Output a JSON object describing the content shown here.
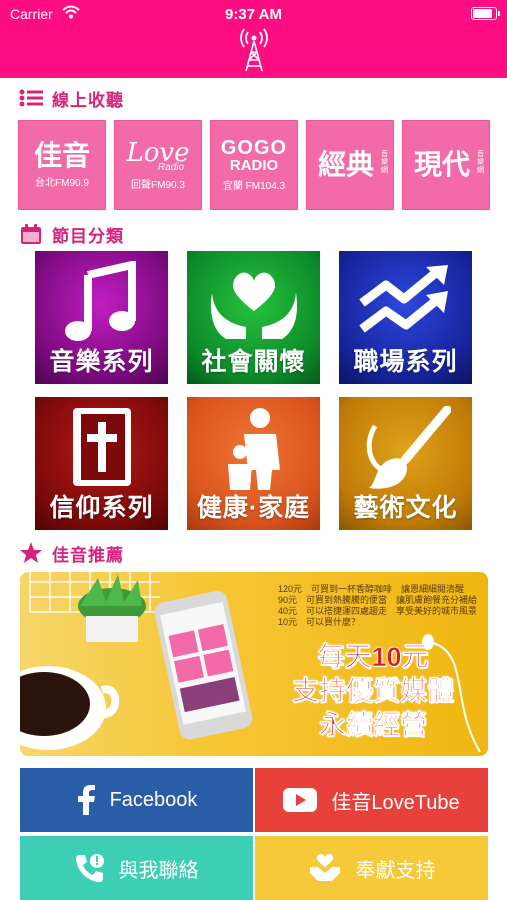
{
  "status_bar": {
    "carrier": "Carrier",
    "time": "9:37 AM"
  },
  "header": {
    "logo_icon": "radio-tower-icon"
  },
  "online": {
    "title": "線上收聽",
    "icon": "list-icon",
    "stations": [
      {
        "name": "佳音",
        "sub": "台北FM90.9"
      },
      {
        "name": "Love",
        "name2": "Radio",
        "sub": "回聲FM90.3"
      },
      {
        "name": "GOGO",
        "name2": "RADIO",
        "sub": "宜蘭 FM104.3"
      },
      {
        "name": "經典",
        "side": "音樂網"
      },
      {
        "name": "現代",
        "side": "音樂網"
      }
    ]
  },
  "categories": {
    "title": "節目分類",
    "icon": "calendar-icon",
    "items": [
      {
        "label": "音樂系列",
        "icon": "music-note-icon",
        "color": "#7a0a7e"
      },
      {
        "label": "社會關懷",
        "icon": "heart-hands-icon",
        "color": "#0d8a2a"
      },
      {
        "label": "職場系列",
        "icon": "trend-arrows-icon",
        "color": "#15249a"
      },
      {
        "label": "信仰系列",
        "icon": "bible-icon",
        "color": "#7d0a0a"
      },
      {
        "label": "健康·家庭",
        "icon": "family-icon",
        "color": "#d9531d"
      },
      {
        "label": "藝術文化",
        "icon": "paintbrush-icon",
        "color": "#c07a06"
      }
    ]
  },
  "recommend": {
    "title": "佳音推薦",
    "icon": "star-icon",
    "banner": {
      "lines": [
        "120元　可買到一杯香醇咖啡　讓恩細細閱清醒",
        "90元　可買到熱騰騰的便當　讓肌膚飽餐充分補給",
        "40元　可以搭捷運四處趨走　享受美好的城市風景",
        "10元　可以買什麼？"
      ],
      "slogan": [
        "每天10元",
        "支持優質媒體",
        "永續經營"
      ]
    }
  },
  "buttons": [
    {
      "label": "Facebook",
      "icon": "facebook-icon",
      "color": "#2a5da7"
    },
    {
      "label": "佳音LoveTube",
      "icon": "youtube-icon",
      "color": "#e8413c"
    },
    {
      "label": "與我聯絡",
      "icon": "phone-icon",
      "color": "#3dcfb5"
    },
    {
      "label": "奉獻支持",
      "icon": "handshake-icon",
      "color": "#f6c93a"
    }
  ]
}
